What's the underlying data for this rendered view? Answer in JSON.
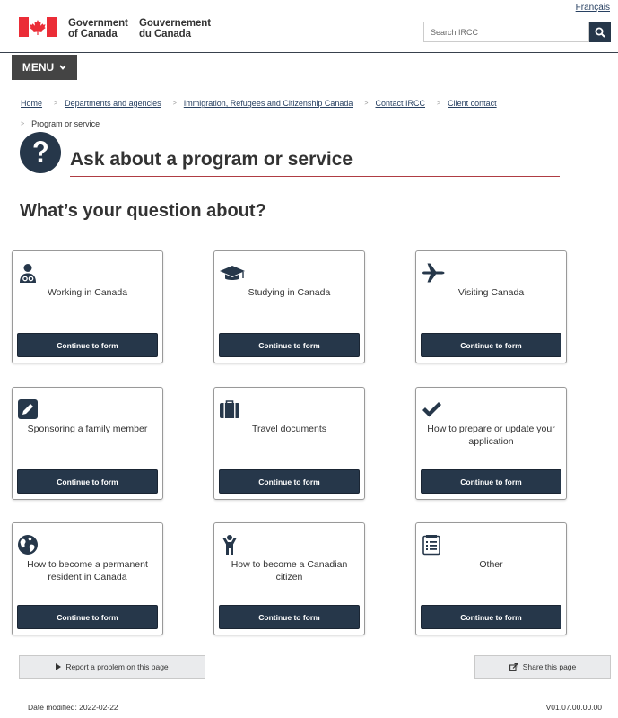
{
  "header": {
    "language_link": "Français",
    "wordmark_en": [
      "Government",
      "of Canada"
    ],
    "wordmark_fr": [
      "Gouvernement",
      "du Canada"
    ],
    "search_placeholder": "Search IRCC",
    "flag_color": "#eb2d37",
    "menu_label": "MENU"
  },
  "breadcrumb": {
    "items": [
      "Home",
      "Departments and agencies",
      "Immigration, Refugees and Citizenship Canada",
      "Contact IRCC",
      "Client contact"
    ],
    "current": "Program or service"
  },
  "page": {
    "title": "Ask about a program or service",
    "question": "What’s your question about?",
    "accent_color": "#26374a",
    "title_rule_color": "#af3c43"
  },
  "cards": [
    {
      "label": "Working in Canada",
      "icon": "user-md-icon",
      "button": "Continue to form"
    },
    {
      "label": "Studying in Canada",
      "icon": "graduation-cap-icon",
      "button": "Continue to form"
    },
    {
      "label": "Visiting Canada",
      "icon": "plane-icon",
      "button": "Continue to form"
    },
    {
      "label": "Sponsoring a family member",
      "icon": "pencil-icon",
      "button": "Continue to form"
    },
    {
      "label": "Travel documents",
      "icon": "suitcase-icon",
      "button": "Continue to form"
    },
    {
      "label": "How to prepare or update your application",
      "icon": "checkmark-icon",
      "button": "Continue to form"
    },
    {
      "label": "How to become a permanent resident in Canada",
      "icon": "globe-icon",
      "button": "Continue to form"
    },
    {
      "label": "How to become a Canadian citizen",
      "icon": "person-icon",
      "button": "Continue to form"
    },
    {
      "label": "Other",
      "icon": "list-icon",
      "button": "Continue to form"
    }
  ],
  "footer": {
    "report_label": "Report a problem on this page",
    "share_label": "Share this page",
    "date_modified": "Date modified: 2022-02-22",
    "version": "V01.07.00.00.00"
  }
}
